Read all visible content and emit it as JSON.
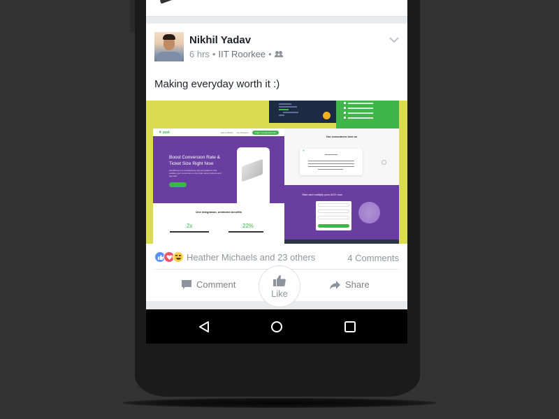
{
  "post": {
    "author": "Nikhil Yadav",
    "time": "6 hrs",
    "separator": "•",
    "location": "IIT Roorkee",
    "audience_icon": "friends-icon",
    "text": "Making everyday worth it :)",
    "menu_icon": "chevron-down-icon"
  },
  "media": {
    "background_color": "#dcdc50",
    "left_mock": {
      "logo": "⚘ zest",
      "nav_links": [
        "How it Works",
        "Our Partners"
      ],
      "nav_cta": "Login / Create Account",
      "hero_title": "Boost Conversion Rate & Ticket Size Right Now",
      "hero_body": "ZestMoney is a revolutionary payment platform that enables your consumers to buy high-value products and pay later",
      "benefits_title": "One integration, unlimited benefits",
      "stat_1": "2x",
      "stat_2": "22%"
    },
    "right_mock": {
      "consumers_title": "Our consumers love us",
      "quote_mark": "“",
      "cta_title": "Start and multiply your AOV now"
    },
    "colors": {
      "purple": "#6a3ea1",
      "green": "#3fb54a",
      "navy": "#1c2a44"
    }
  },
  "reactions": {
    "icons": [
      "like-reaction-icon",
      "love-reaction-icon",
      "haha-reaction-icon"
    ],
    "summary": "Heather Michaels and 23 others",
    "comments": "4 Comments"
  },
  "actions": {
    "comment": "Comment",
    "like": "Like",
    "share": "Share"
  },
  "navbar": {
    "back": "back-icon",
    "home": "home-icon",
    "recents": "recents-icon"
  }
}
